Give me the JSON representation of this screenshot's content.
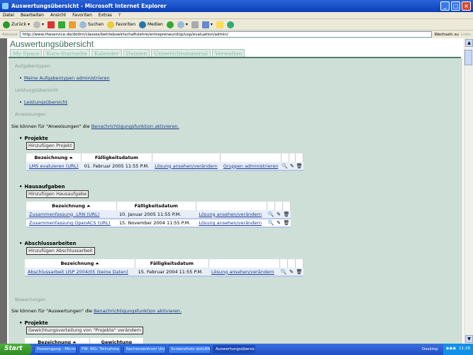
{
  "window": {
    "title": "Auswertungsübersicht - Microsoft Internet Explorer"
  },
  "menu": [
    "Datei",
    "Bearbeiten",
    "Ansicht",
    "Favoriten",
    "Extras",
    "?"
  ],
  "toolbar": {
    "back": "Zurück",
    "search": "Suchen",
    "favorites": "Favoriten",
    "media": "Medien"
  },
  "address": {
    "label": "Adresse",
    "url": "http://www.theservice.de/dotlrn/classes/betriebswirtschaftslehre/entrepreneurship/usp/evaluation/admin/",
    "go": "Wechseln zu",
    "links": "Links"
  },
  "page": {
    "title": "Auswertungsübersicht",
    "tabs": [
      "My Space",
      "Kurs-Startseite",
      "Kalender",
      "Dateien",
      "Unterrichtsmaterial",
      "Verwalten"
    ],
    "aufgabentypen": {
      "heading": "Aufgabentypen",
      "link": "Meine Aufgabentypen administrieren"
    },
    "leistung": {
      "heading": "Leistungsübersicht",
      "link": "Leistungsübersicht"
    },
    "anweisungen": {
      "heading": "Anweisungen",
      "notice_pre": "Sie können für \"Anweisungen\" die ",
      "notice_link": "Benachrichtigungsfunktion aktivieren."
    },
    "projekte": {
      "title": "Projekte",
      "button": "Hinzufügen Projekt",
      "headers": [
        "Bezeichnung ⏶",
        "Fälligkeitsdatum"
      ],
      "rows": [
        {
          "name": "LMS evaluieren (URL)",
          "date": "01. Februar 2005 11:55 P.M.",
          "action": "Lösung ansehen/verändern",
          "extra": "Gruppen administrieren"
        }
      ]
    },
    "hausaufgaben": {
      "title": "Hausaufgaben",
      "button": "Hinzufügen Hausaufgabe",
      "headers": [
        "Bezeichnung ⏶",
        "Fälligkeitsdatum"
      ],
      "rows": [
        {
          "name": "Zusammenfassung .LRN (URL)",
          "date": "10. Januar 2005 11:55 P.M.",
          "action": "Lösung ansehen/verändern"
        },
        {
          "name": "Zusammenfassung OpenACS (URL)",
          "date": "15. November 2004 11:55 P.M.",
          "action": "Lösung ansehen/verändern"
        }
      ]
    },
    "abschluss": {
      "title": "Abschlussarbeiten",
      "button": "Hinzufügen Abschlussarbeit",
      "headers": [
        "Bezeichnung ⏶",
        "Fälligkeitsdatum"
      ],
      "rows": [
        {
          "name": "Abschlussarbeit USP 2004/05 (keine Daten)",
          "date": "15. Februar 2004 11:55 P.M.",
          "action": "Lösung ansehen/verändern"
        }
      ]
    },
    "bewertungen": {
      "heading": "Bewertungen",
      "notice_pre": "Sie können für \"Auswertungen\" die ",
      "notice_link": "Benachrichtigungsfunktion aktivieren.",
      "projekte_title": "Projekte",
      "button": "Gewichtungsverteilung von \"Projekte\" verändern",
      "headers": [
        "Bezeichnung ⏶",
        "Gewichtung"
      ]
    }
  },
  "taskbar": {
    "start": "Start",
    "tasks": [
      "Posteingang - Micros...",
      "FW: WG: Teilnahme v...",
      "Rechenzentrum Uni K...",
      "Screenshots dotLRN....",
      "Auswertungsübersich..."
    ],
    "desktop": "Desktop",
    "clock": "11:28"
  }
}
